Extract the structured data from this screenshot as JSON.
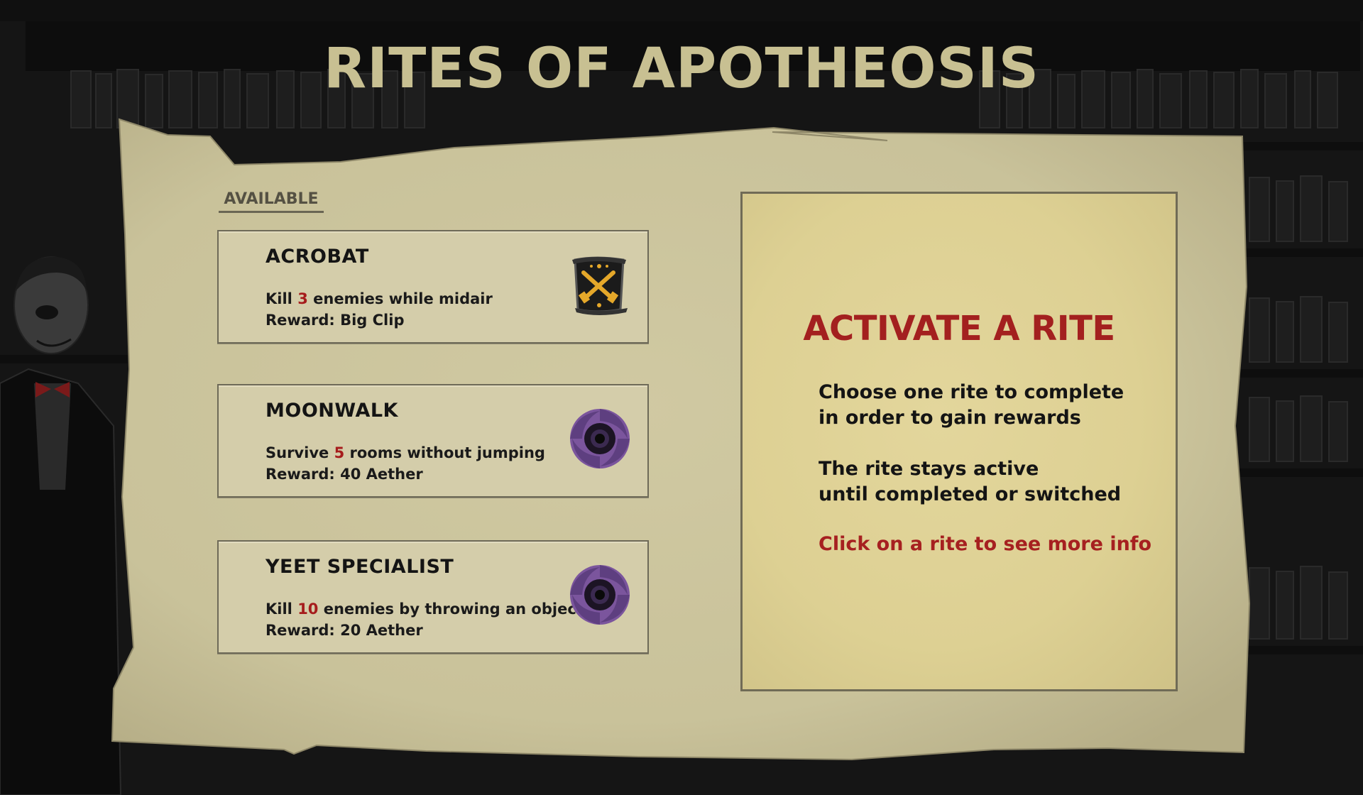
{
  "title": "RITES OF APOTHEOSIS",
  "section_label": "AVAILABLE",
  "rites": [
    {
      "name": "ACROBAT",
      "desc_before": "Kill ",
      "count": "3",
      "desc_after": " enemies while midair",
      "reward": "Reward: Big Clip",
      "icon": "crossed-pistols-scroll-icon"
    },
    {
      "name": "MOONWALK",
      "desc_before": "Survive ",
      "count": "5",
      "desc_after": " rooms without jumping",
      "reward": "Reward: 40 Aether",
      "icon": "aether-vortex-icon"
    },
    {
      "name": "YEET SPECIALIST",
      "desc_before": "Kill ",
      "count": "10",
      "desc_after": " enemies by throwing an object",
      "reward": "Reward: 20 Aether",
      "icon": "aether-vortex-icon"
    }
  ],
  "info": {
    "title": "ACTIVATE A RITE",
    "line1": "Choose one rite to complete",
    "line2": "in order to gain rewards",
    "line3": "The rite stays active",
    "line4": "until completed or switched",
    "hint": "Click on a rite to see more info"
  },
  "colors": {
    "highlight": "#a61c1c",
    "parchment": "#cbc49c",
    "title": "#c8c092",
    "vortex": "#7b559d"
  }
}
